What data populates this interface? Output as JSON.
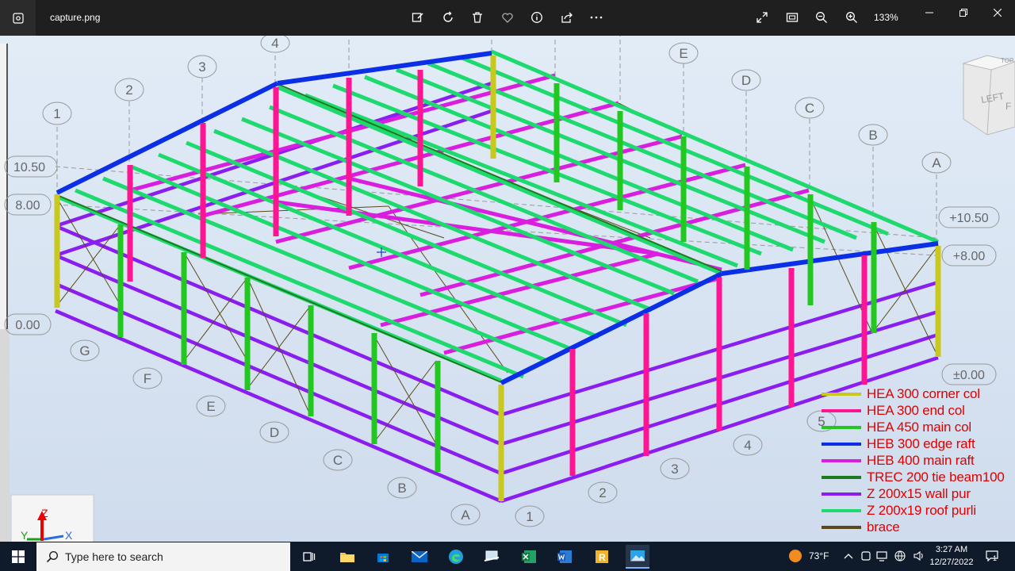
{
  "window": {
    "file_name": "capture.png",
    "zoom_level": "133%"
  },
  "toolbar": {
    "icons": [
      "edit-image-icon",
      "rotate-icon",
      "delete-icon",
      "favorite-icon",
      "info-icon",
      "share-icon",
      "more-icon",
      "fullscreen-icon",
      "fit-window-icon",
      "zoom-out-icon",
      "zoom-in-icon"
    ]
  },
  "model": {
    "grid_numbers": [
      "1",
      "2",
      "3",
      "4",
      "5",
      "1",
      "2",
      "3",
      "4",
      "5"
    ],
    "grid_letters_right": [
      "A",
      "B",
      "C",
      "D",
      "E"
    ],
    "grid_letters_left": [
      "G",
      "F",
      "E",
      "D",
      "C",
      "B",
      "A"
    ],
    "level_labels_left": [
      "10.50",
      "8.00",
      "0.00"
    ],
    "level_labels_right": [
      "+10.50",
      "+8.00",
      "±0.00"
    ],
    "view_cube_labels": [
      "LEFT",
      "F",
      "TOP"
    ],
    "axis_labels": {
      "z": "Z",
      "x": "X",
      "y": "Y"
    }
  },
  "legend": [
    {
      "label": "HEA 300 corner col",
      "color": "#c8c81e"
    },
    {
      "label": "HEA 300 end col",
      "color": "#ff1493"
    },
    {
      "label": "HEA 450 main col",
      "color": "#22c71f"
    },
    {
      "label": "HEB 300 edge raft",
      "color": "#0a2fe6"
    },
    {
      "label": "HEB 400 main raft",
      "color": "#d91ee0"
    },
    {
      "label": "TREC 200 tie beam100",
      "color": "#1e7a1e"
    },
    {
      "label": "Z 200x15 wall pur",
      "color": "#8a1ef0"
    },
    {
      "label": "Z 200x19 roof purli",
      "color": "#1ed96e"
    },
    {
      "label": "brace",
      "color": "#5a4a1a"
    }
  ],
  "taskbar": {
    "search_placeholder": "Type here to search",
    "weather": "73°F",
    "time": "3:27 AM",
    "date": "12/27/2022",
    "notification_count": "1"
  }
}
